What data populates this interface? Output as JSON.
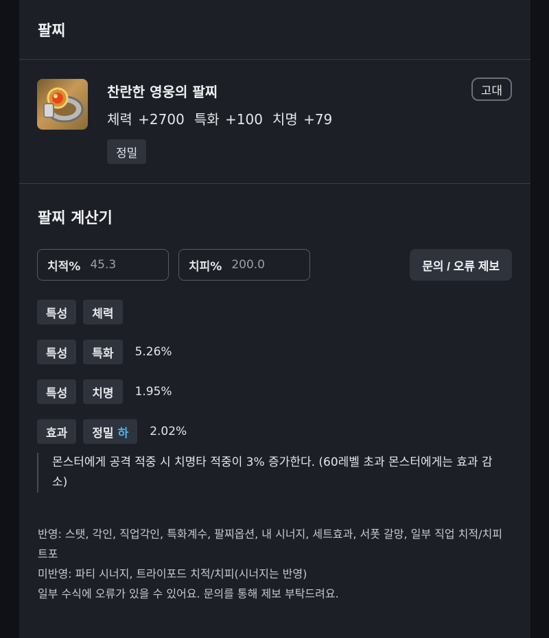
{
  "header": {
    "title": "팔찌"
  },
  "item": {
    "name": "찬란한 영웅의 팔찌",
    "grade": "고대",
    "stats": [
      "체력 +2700",
      "특화 +100",
      "치명 +79"
    ],
    "tag": "정밀"
  },
  "calculator": {
    "title": "팔찌 계산기",
    "crit_rate": {
      "label": "치적%",
      "value": "45.3"
    },
    "crit_damage": {
      "label": "치피%",
      "value": "200.0"
    },
    "report_button": "문의 / 오류 제보",
    "rows": [
      {
        "kind": "특성",
        "name": "체력",
        "value": ""
      },
      {
        "kind": "특성",
        "name": "특화",
        "value": "5.26%"
      },
      {
        "kind": "특성",
        "name": "치명",
        "value": "1.95%"
      },
      {
        "kind": "효과",
        "name": "정밀",
        "grade": "하",
        "value": "2.02%"
      }
    ],
    "effect_description": "몬스터에게 공격 적중 시 치명타 적중이 3% 증가한다. (60레벨 초과 몬스터에게는 효과 감소)",
    "notes": [
      "반영: 스탯, 각인, 직업각인, 특화계수, 팔찌옵션, 내 시너지, 세트효과, 서폿 갈망, 일부 직업 치적/치피 트포",
      "미반영: 파티 시너지, 트라이포드 치적/치피(시너지는 반영)",
      "일부 수식에 오류가 있을 수 있어요. 문의를 통해 제보 부탁드려요."
    ]
  },
  "colors": {
    "grade_low": "#4ab3ef",
    "panel": "#1c1f26",
    "tag_bg": "#2e333c"
  }
}
